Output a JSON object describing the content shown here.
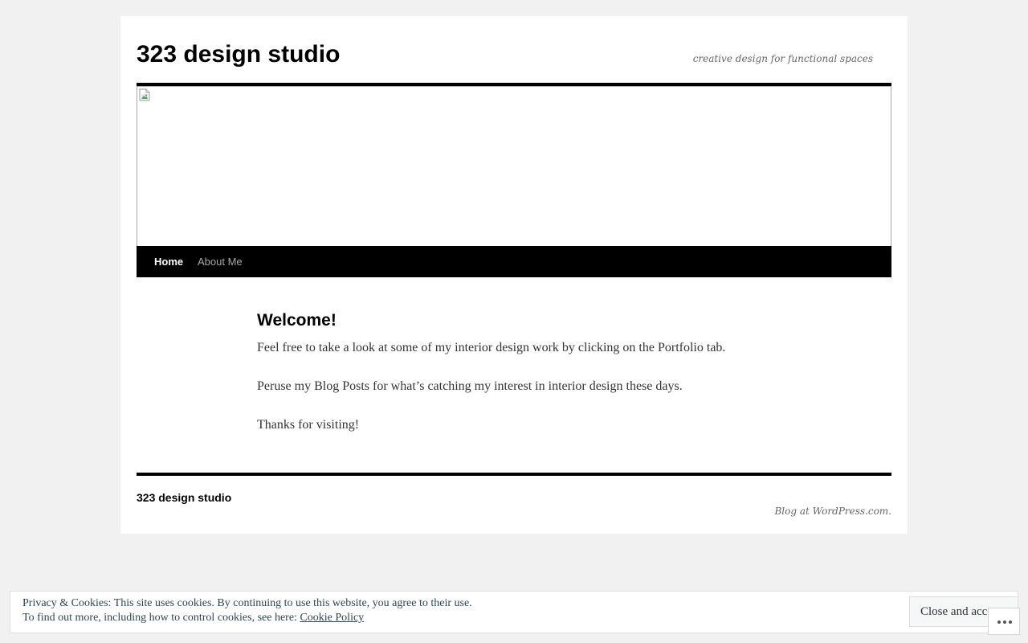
{
  "header": {
    "site_title": "323 design studio",
    "tagline": "creative design for functional spaces",
    "header_image_icon": "broken-image-icon"
  },
  "nav": {
    "items": [
      {
        "label": "Home",
        "active": true
      },
      {
        "label": "About Me",
        "active": false
      }
    ]
  },
  "content": {
    "title": "Welcome!",
    "paragraphs": [
      "Feel free to take a look at some of my interior design work by clicking on the Portfolio tab.",
      "Peruse my Blog Posts for what’s catching my interest in interior design these days.",
      "Thanks for visiting!"
    ]
  },
  "footer": {
    "site_name": "323 design studio",
    "credit": "Blog at WordPress.com."
  },
  "cookie_banner": {
    "line1": "Privacy & Cookies: This site uses cookies. By continuing to use this website, you agree to their use.",
    "line2_prefix": "To find out more, including how to control cookies, see here: ",
    "link_label": "Cookie Policy",
    "close_label": "Close and accept"
  },
  "actions": {
    "icon": "ellipsis-icon"
  },
  "colors": {
    "page_background": "#f1f1f1",
    "wrapper_background": "#ffffff",
    "nav_background": "#000000",
    "nav_active_text": "#ffffff",
    "nav_inactive_text": "#aaaaaa",
    "banner_text": "#2e4453"
  }
}
